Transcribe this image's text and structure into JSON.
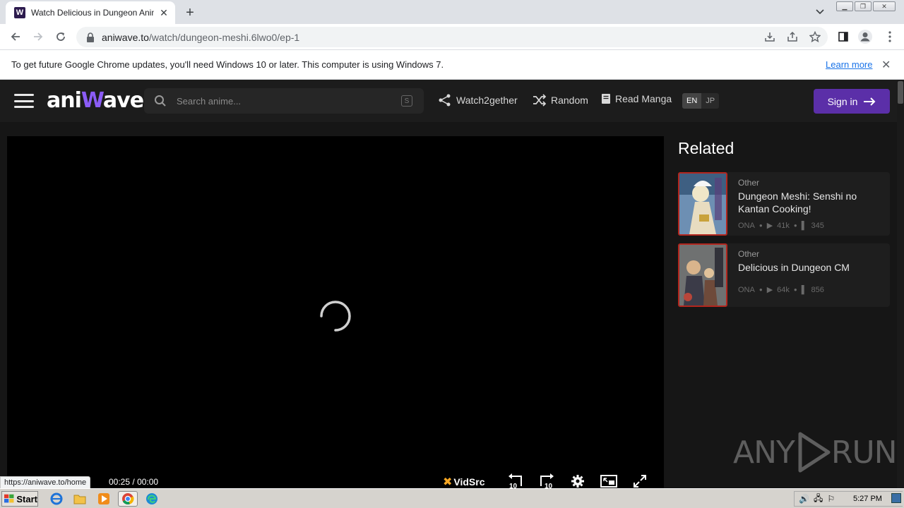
{
  "browser": {
    "tab_title": "Watch Delicious in Dungeon Anime O",
    "favicon_letter": "W",
    "url_host": "aniwave.to",
    "url_path": "/watch/dungeon-meshi.6lwo0/ep-1",
    "status_url": "https://aniwave.to/home"
  },
  "infobar": {
    "message": "To get future Google Chrome updates, you'll need Windows 10 or later. This computer is using Windows 7.",
    "learn_more": "Learn more"
  },
  "site": {
    "logo_left": "ani",
    "logo_w": "W",
    "logo_right": "ave",
    "search_placeholder": "Search anime...",
    "search_key": "S",
    "nav": {
      "watch2gether": "Watch2gether",
      "random": "Random",
      "read_manga": "Read Manga"
    },
    "lang_en": "EN",
    "lang_jp": "JP",
    "signin": "Sign in",
    "accent": "#5b2fa8"
  },
  "player": {
    "time_current": "00:25",
    "time_sep": "/",
    "time_total": "00:00",
    "source_label": "VidSrc",
    "skip_back": "10",
    "skip_fwd": "10"
  },
  "related": {
    "heading": "Related",
    "items": [
      {
        "category": "Other",
        "title": "Dungeon Meshi: Senshi no Kantan Cooking!",
        "type": "ONA",
        "views": "41k",
        "bookmarks": "345"
      },
      {
        "category": "Other",
        "title": "Delicious in Dungeon CM",
        "type": "ONA",
        "views": "64k",
        "bookmarks": "856"
      }
    ]
  },
  "watermark": {
    "left": "ANY",
    "right": "RUN"
  },
  "taskbar": {
    "start": "Start",
    "clock": "5:27 PM"
  }
}
